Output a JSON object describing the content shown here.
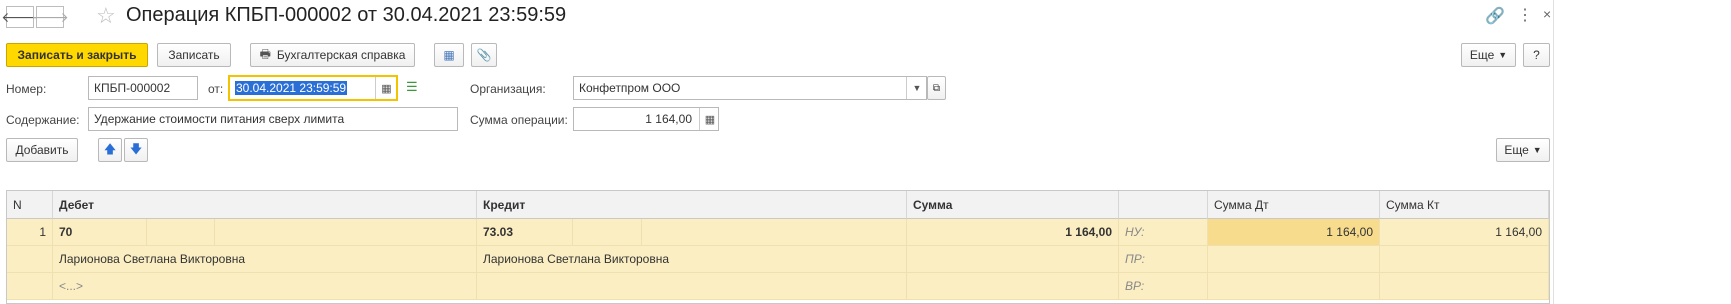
{
  "window": {
    "title": "Операция КПБП-000002 от 30.04.2021 23:59:59",
    "back_icon": "arrow-left-icon",
    "forward_icon": "arrow-right-icon",
    "favorite_icon": "star-icon",
    "link_icon": "link-icon",
    "more_icon": "vertical-dots-icon"
  },
  "toolbar": {
    "save_close_label": "Записать и закрыть",
    "save_label": "Записать",
    "report_label": "Бухгалтерская справка",
    "more_label": "Еще",
    "help_label": "?"
  },
  "form": {
    "number_label": "Номер:",
    "number_value": "КПБП-000002",
    "date_label": "от:",
    "date_value": "30.04.2021 23:59:59",
    "org_label": "Организация:",
    "org_value": "Конфетпром ООО",
    "content_label": "Содержание:",
    "content_value": "Удержание стоимости питания сверх лимита",
    "sum_label": "Сумма операции:",
    "sum_value": "1 164,00"
  },
  "table_toolbar": {
    "add_label": "Добавить",
    "more_label": "Еще"
  },
  "table": {
    "columns": [
      "N",
      "Дебет",
      "Кредит",
      "Сумма",
      "Сумма Дт",
      "Сумма Кт"
    ],
    "rows": [
      {
        "n": "1",
        "debit_account": "70",
        "debit_sub1": "Ларионова Светлана Викторовна",
        "debit_sub2": "<...>",
        "credit_account": "73.03",
        "credit_sub1": "Ларионова Светлана Викторовна",
        "sum": "1 164,00",
        "nu_label": "НУ:",
        "pr_label": "ПР:",
        "vr_label": "ВР:",
        "sum_dt": "1 164,00",
        "sum_kt": "1 164,00"
      }
    ]
  },
  "colors": {
    "accent": "#ffd800",
    "row_selected": "#fbeec2",
    "cell_active": "#f7dc8e"
  }
}
